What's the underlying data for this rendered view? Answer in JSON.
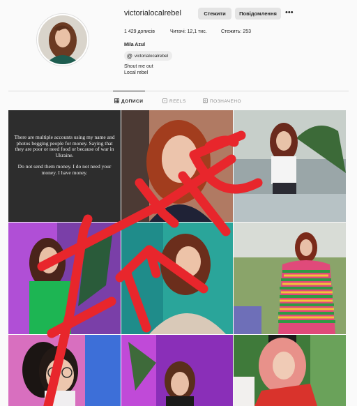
{
  "profile": {
    "username": "victorialocalrebel",
    "follow_label": "Стежити",
    "message_label": "Повідомлення",
    "more_label": "•••",
    "posts_stat": "1 429 дописів",
    "followers_stat": "Читачі: 12,1 тис.",
    "following_stat": "Стежить: 253",
    "full_name": "Mila Azul",
    "threads_handle": "victorialocalrebel",
    "threads_icon": "threads-icon",
    "bio": [
      "Shout me out",
      "Local rebel"
    ]
  },
  "tabs": [
    {
      "label": "ДОПИСИ",
      "icon": "grid-icon",
      "active": true
    },
    {
      "label": "REELS",
      "icon": "reels-icon",
      "active": false
    },
    {
      "label": "ПОЗНАЧЕНО",
      "icon": "tagged-icon",
      "active": false
    }
  ],
  "text_post": {
    "paragraph_1": "There are multiple accounts using my name and photos begging people for money. Saying that they are poor or need food or because of war in Ukraine.",
    "paragraph_2": "Do not send them money. I do not need your money. I have money."
  },
  "overlay": {
    "handwritten_word": "FAKE",
    "color": "#e8262c"
  },
  "colors": {
    "background": "#fafafa",
    "button_bg": "#e4e4e4",
    "text": "#262626",
    "muted": "#8e8e8e"
  }
}
